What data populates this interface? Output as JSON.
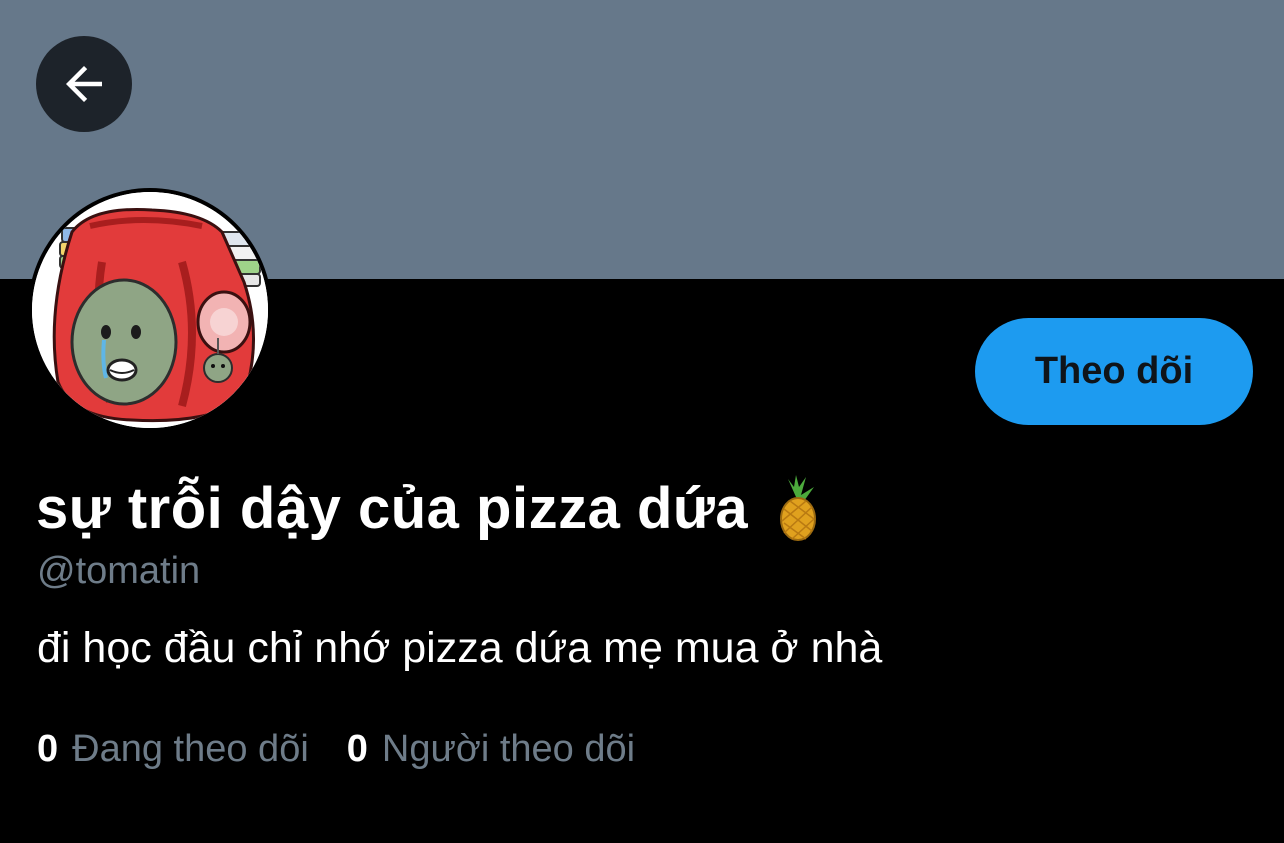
{
  "header": {
    "back_icon": "arrow-left-icon"
  },
  "colors": {
    "banner": "#66788a",
    "background": "#000000",
    "accent": "#1d9bf0",
    "muted_text": "#6e7c89",
    "primary_text": "#ffffff"
  },
  "profile": {
    "avatar_description_icon": "avatar-image",
    "follow_label": "Theo dõi",
    "display_name": "sự trỗi dậy của pizza dứa",
    "name_emoji_icon": "pineapple-icon",
    "handle": "@tomatin",
    "bio": "đi học đầu chỉ nhớ pizza dứa mẹ mua ở nhà",
    "stats": {
      "following_count": "0",
      "following_label": "Đang theo dõi",
      "followers_count": "0",
      "followers_label": "Người theo dõi"
    }
  }
}
